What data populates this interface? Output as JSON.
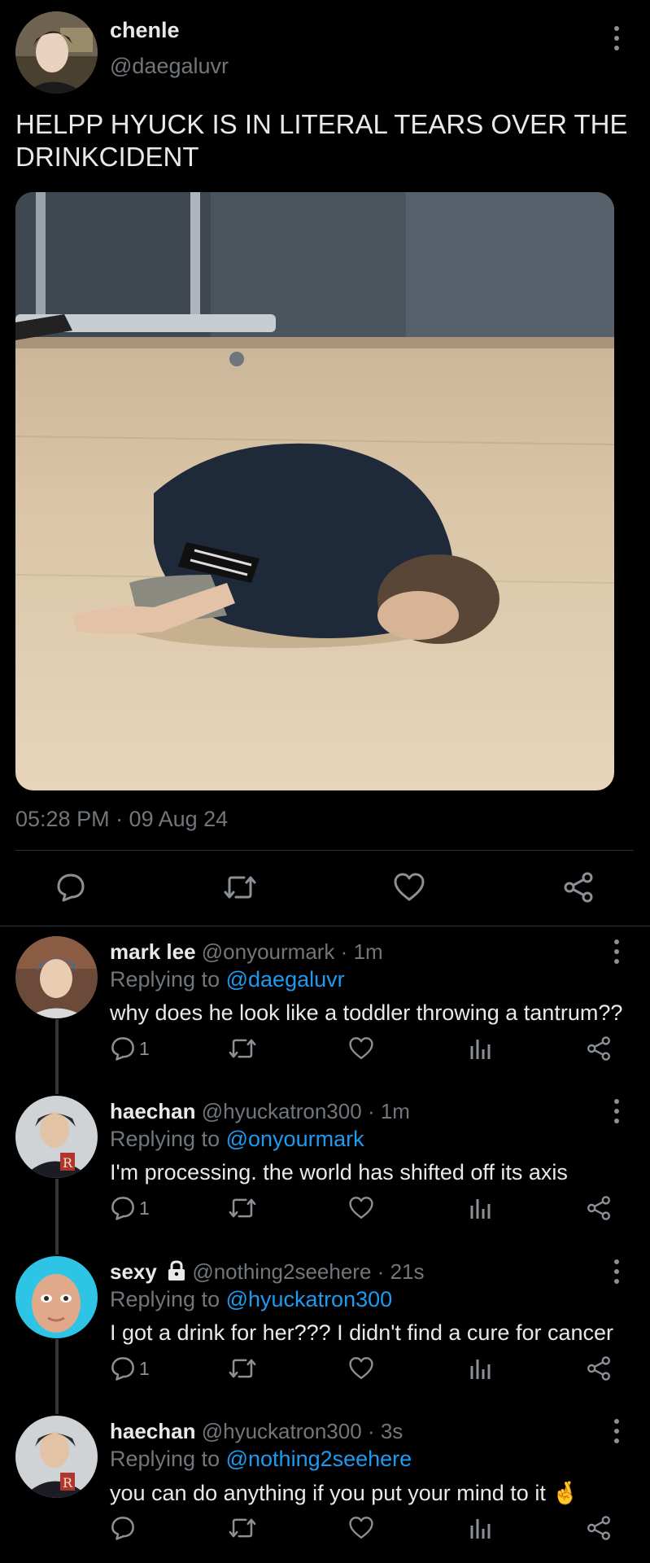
{
  "main_tweet": {
    "display_name": "chenle",
    "handle": "@daegaluvr",
    "text": "HELPP HYUCK IS IN LITERAL TEARS OVER THE DRINKCIDENT",
    "timestamp": "05:28 PM · 09 Aug 24",
    "actions": [
      "reply-icon",
      "retweet-icon",
      "like-icon",
      "share-icon"
    ]
  },
  "replies": [
    {
      "display_name": "mark lee",
      "handle": "@onyourmark",
      "time": "1m",
      "replying_prefix": "Replying to",
      "replying_to": "@daegaluvr",
      "text": "why does he look like a toddler throwing a tantrum??",
      "reply_count": "1"
    },
    {
      "display_name": "haechan",
      "handle": "@hyuckatron300",
      "time": "1m",
      "replying_prefix": "Replying to",
      "replying_to": "@onyourmark",
      "text": "I'm processing. the world has shifted off its axis",
      "reply_count": "1"
    },
    {
      "display_name": "sexy",
      "handle": "@nothing2seehere",
      "time": "21s",
      "replying_prefix": "Replying to",
      "replying_to": "@hyuckatron300",
      "text": "I got a drink for her??? I didn't find a cure for cancer",
      "reply_count": "1",
      "locked": true
    },
    {
      "display_name": "haechan",
      "handle": "@hyuckatron300",
      "time": "3s",
      "replying_prefix": "Replying to",
      "replying_to": "@nothing2seehere",
      "text": "you can do anything if you put your mind to it 🤞",
      "reply_count": ""
    }
  ],
  "separator": "·",
  "colors": {
    "background": "#000000",
    "text": "#e7e9ea",
    "secondary": "#71767b",
    "link": "#1d9bf0",
    "divider": "#2f3336"
  }
}
